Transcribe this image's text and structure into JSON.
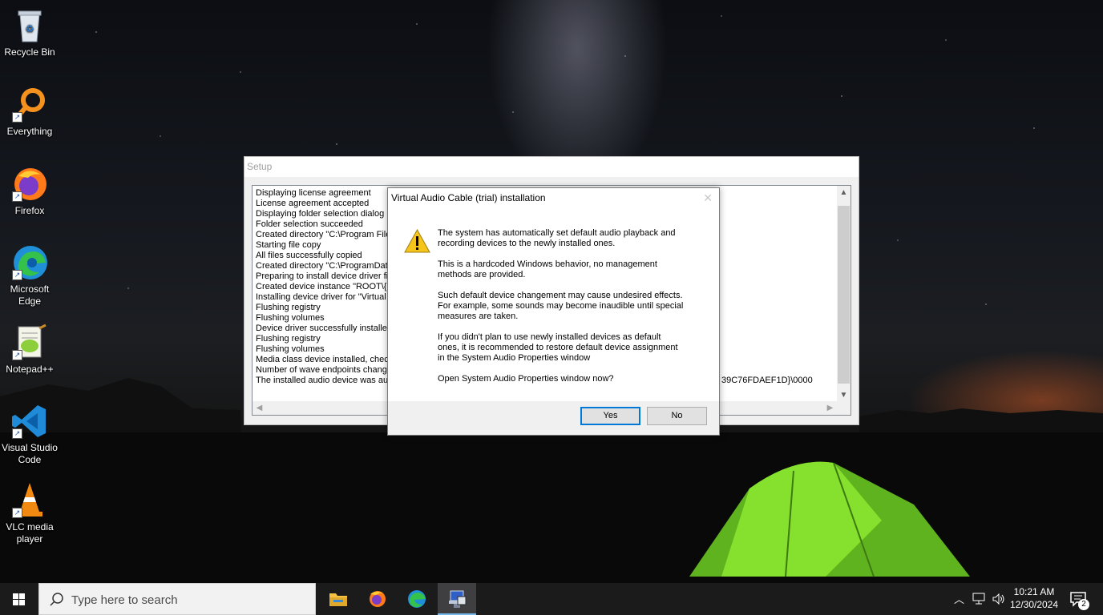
{
  "desktop": {
    "icons": [
      {
        "label": "Recycle Bin"
      },
      {
        "label": "Everything"
      },
      {
        "label": "Firefox"
      },
      {
        "label": "Microsoft Edge"
      },
      {
        "label": "Notepad++"
      },
      {
        "label": "Visual Studio Code"
      },
      {
        "label": "VLC media player"
      }
    ]
  },
  "setup_window": {
    "title": "Setup",
    "log_lines": [
      "Displaying license agreement",
      "License agreement accepted",
      "Displaying folder selection dialog",
      "Folder selection succeeded",
      "Created directory \"C:\\Program File",
      "Starting file copy",
      "All files successfully copied",
      "Created directory \"C:\\ProgramDat",
      "Preparing to install device driver fi",
      "Created device instance \"ROOT\\{8",
      "Installing device driver for \"Virtual",
      "Flushing registry",
      "Flushing volumes",
      "Device driver successfully installed",
      "Flushing registry",
      "Flushing volumes",
      "Media class device installed, check",
      "Number of wave endpoints change",
      "The installed audio device was aut"
    ],
    "log_tail_visible": "39C76FDAEF1D}\\0000"
  },
  "dialog": {
    "title": "Virtual Audio Cable (trial) installation",
    "paragraphs": [
      "The system has automatically set default audio playback and\nrecording devices to the newly installed ones.",
      "This is a hardcoded Windows behavior, no management\nmethods are provided.",
      "Such default device changement may cause undesired effects.\nFor example, some sounds may become inaudible until special\nmeasures are taken.",
      "If you didn't plan to use newly installed devices as default\nones, it is recommended to restore default device assignment\nin the System Audio Properties window",
      "Open System Audio Properties window now?"
    ],
    "yes_label": "Yes",
    "no_label": "No"
  },
  "taskbar": {
    "search_placeholder": "Type here to search",
    "time": "10:21 AM",
    "date": "12/30/2024",
    "notification_count": "2"
  },
  "colors": {
    "accent": "#0078d7",
    "taskbar": "#1b1b1c",
    "tent_green": "#7ddc2a"
  }
}
